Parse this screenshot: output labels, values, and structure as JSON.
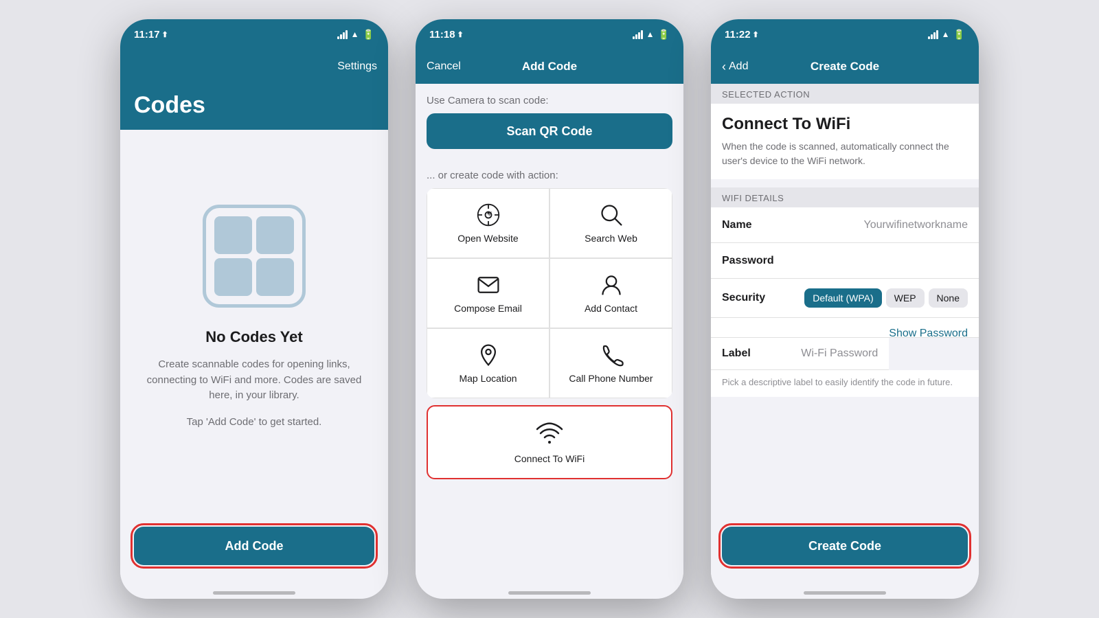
{
  "phone1": {
    "status": {
      "time": "11:17",
      "location": true
    },
    "nav": {
      "right_label": "Settings",
      "title": ""
    },
    "header": {
      "title": "Codes"
    },
    "empty_state": {
      "title": "No Codes Yet",
      "description": "Create scannable codes for opening links, connecting to WiFi and more. Codes are saved here, in your library.",
      "hint": "Tap 'Add Code' to get started."
    },
    "add_button": "Add Code"
  },
  "phone2": {
    "status": {
      "time": "11:18",
      "location": true
    },
    "nav": {
      "left_label": "Cancel",
      "title": "Add Code"
    },
    "scan_label": "Use Camera to scan code:",
    "scan_button": "Scan QR Code",
    "create_label": "... or create code with action:",
    "actions": [
      {
        "label": "Open Website",
        "icon": "compass"
      },
      {
        "label": "Search Web",
        "icon": "search"
      },
      {
        "label": "Compose Email",
        "icon": "email"
      },
      {
        "label": "Add Contact",
        "icon": "contact"
      },
      {
        "label": "Map Location",
        "icon": "location"
      },
      {
        "label": "Call Phone Number",
        "icon": "phone"
      }
    ],
    "wifi_action": {
      "label": "Connect To WiFi",
      "icon": "wifi"
    }
  },
  "phone3": {
    "status": {
      "time": "11:22",
      "location": true
    },
    "nav": {
      "left_label": "Add",
      "title": "Create Code"
    },
    "selected_action_header": "Selected Action",
    "selected_action_title": "Connect To WiFi",
    "selected_action_desc": "When the code is scanned, automatically connect the user's device to the WiFi network.",
    "wifi_details_header": "WiFi Details",
    "fields": {
      "name_label": "Name",
      "name_value": "Yourwifinetworkname",
      "password_label": "Password",
      "password_value": "",
      "security_label": "Security",
      "security_options": [
        "Default (WPA)",
        "WEP",
        "None"
      ],
      "show_password": "Show Password",
      "label_label": "Label",
      "label_value": "Wi-Fi Password",
      "label_hint": "Pick a descriptive label to easily identify the code in future."
    },
    "create_button": "Create Code"
  }
}
